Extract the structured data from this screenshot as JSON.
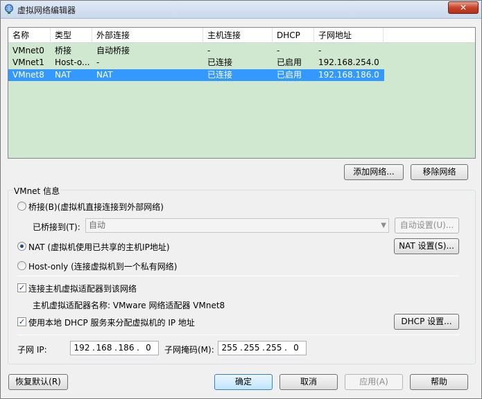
{
  "window": {
    "title": "虚拟网络编辑器",
    "close_label": "✕"
  },
  "network_list": {
    "columns": [
      "名称",
      "类型",
      "外部连接",
      "主机连接",
      "DHCP",
      "子网地址"
    ],
    "rows": [
      {
        "name": "VMnet0",
        "type": "桥接",
        "external": "自动桥接",
        "host": "-",
        "dhcp": "-",
        "subnet": "-"
      },
      {
        "name": "VMnet1",
        "type": "Host-o...",
        "external": "-",
        "host": "已连接",
        "dhcp": "已启用",
        "subnet": "192.168.254.0"
      },
      {
        "name": "VMnet8",
        "type": "NAT",
        "external": "NAT",
        "host": "已连接",
        "dhcp": "已启用",
        "subnet": "192.168.186.0"
      }
    ],
    "selected_row": "VMnet8"
  },
  "list_buttons": {
    "add": "添加网络...",
    "remove": "移除网络"
  },
  "vmnet_info": {
    "group_label": "VMnet 信息",
    "bridged_label": "桥接(B)(虚拟机直接连接到外部网络)",
    "bridged_to_label": "已桥接到(T):",
    "bridged_to_value": "自动",
    "auto_settings": "自动设置(U)...",
    "nat_label": "NAT (虚拟机使用已共享的主机IP地址)",
    "nat_settings": "NAT 设置(S)...",
    "hostonly_label": "Host-only (连接虚拟机到一个私有网络)",
    "connect_adapter_label": "连接主机虚拟适配器到该网络",
    "adapter_name_label": "主机虚拟适配器名称: VMware 网络适配器 VMnet8",
    "dhcp_label": "使用本地 DHCP 服务来分配虚拟机的 IP 地址",
    "dhcp_settings": "DHCP 设置...",
    "subnet_ip_label": "子网 IP:",
    "subnet_ip": [
      "192",
      "168",
      "186",
      "0"
    ],
    "subnet_mask_label": "子网掩码(M):",
    "subnet_mask": [
      "255",
      "255",
      "255",
      "0"
    ],
    "selected_mode": "nat",
    "connect_adapter_checked": true,
    "dhcp_checked": true
  },
  "footer": {
    "restore": "恢复默认(R)",
    "ok": "确定",
    "cancel": "取消",
    "apply": "应用(A)",
    "help": "帮助"
  }
}
